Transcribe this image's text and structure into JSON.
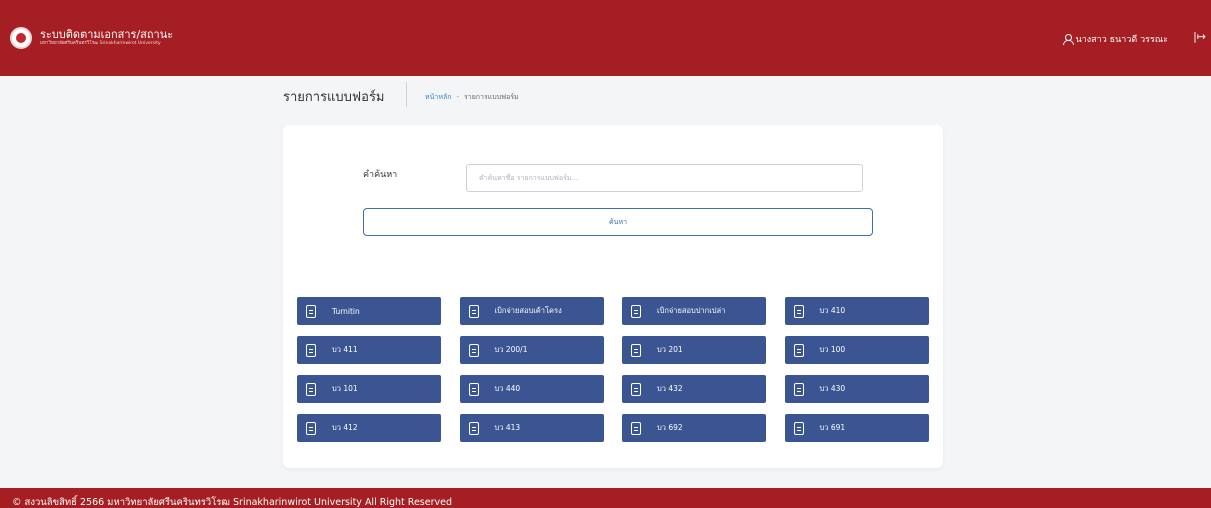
{
  "header": {
    "app_title": "ระบบติดตามเอกสาร/สถานะ",
    "app_subtitle": "มหาวิทยาลัยศรีนครินทรวิโรฒ Srinakharinwirot University",
    "user_name": "นางสาว ธนาวดี วรรณะ",
    "logout_icon": "logout-icon"
  },
  "page": {
    "title": "รายการแบบฟอร์ม",
    "breadcrumb": {
      "home": "หน้าหลัก",
      "separator": "-",
      "current": "รายการแบบฟอร์ม"
    }
  },
  "search": {
    "label": "คำค้นหา",
    "placeholder": "คำค้นหาชื่อ รายการแบบฟอร์ม...",
    "button": "ค้นหา"
  },
  "forms": [
    {
      "label": "Turnitin"
    },
    {
      "label": "เบิกจ่ายสอบเค้าโครง"
    },
    {
      "label": "เบิกจ่ายสอบปากเปล่า"
    },
    {
      "label": "บว 410"
    },
    {
      "label": "บว 411"
    },
    {
      "label": "บว 200/1"
    },
    {
      "label": "บว 201"
    },
    {
      "label": "บว 100"
    },
    {
      "label": "บว 101"
    },
    {
      "label": "บว 440"
    },
    {
      "label": "บว 432"
    },
    {
      "label": "บว 430"
    },
    {
      "label": "บว 412"
    },
    {
      "label": "บว 413"
    },
    {
      "label": "บว 692"
    },
    {
      "label": "บว 691"
    }
  ],
  "footer": {
    "copyright": "© สงวนลิขสิทธิ์ 2566 มหาวิทยาลัยศรีนครินทรวิโรฒ Srinakharinwirot University All Right Reserved"
  },
  "colors": {
    "header_bg": "#a51e23",
    "form_button_bg": "#3b5592",
    "link": "#2f86d9"
  }
}
